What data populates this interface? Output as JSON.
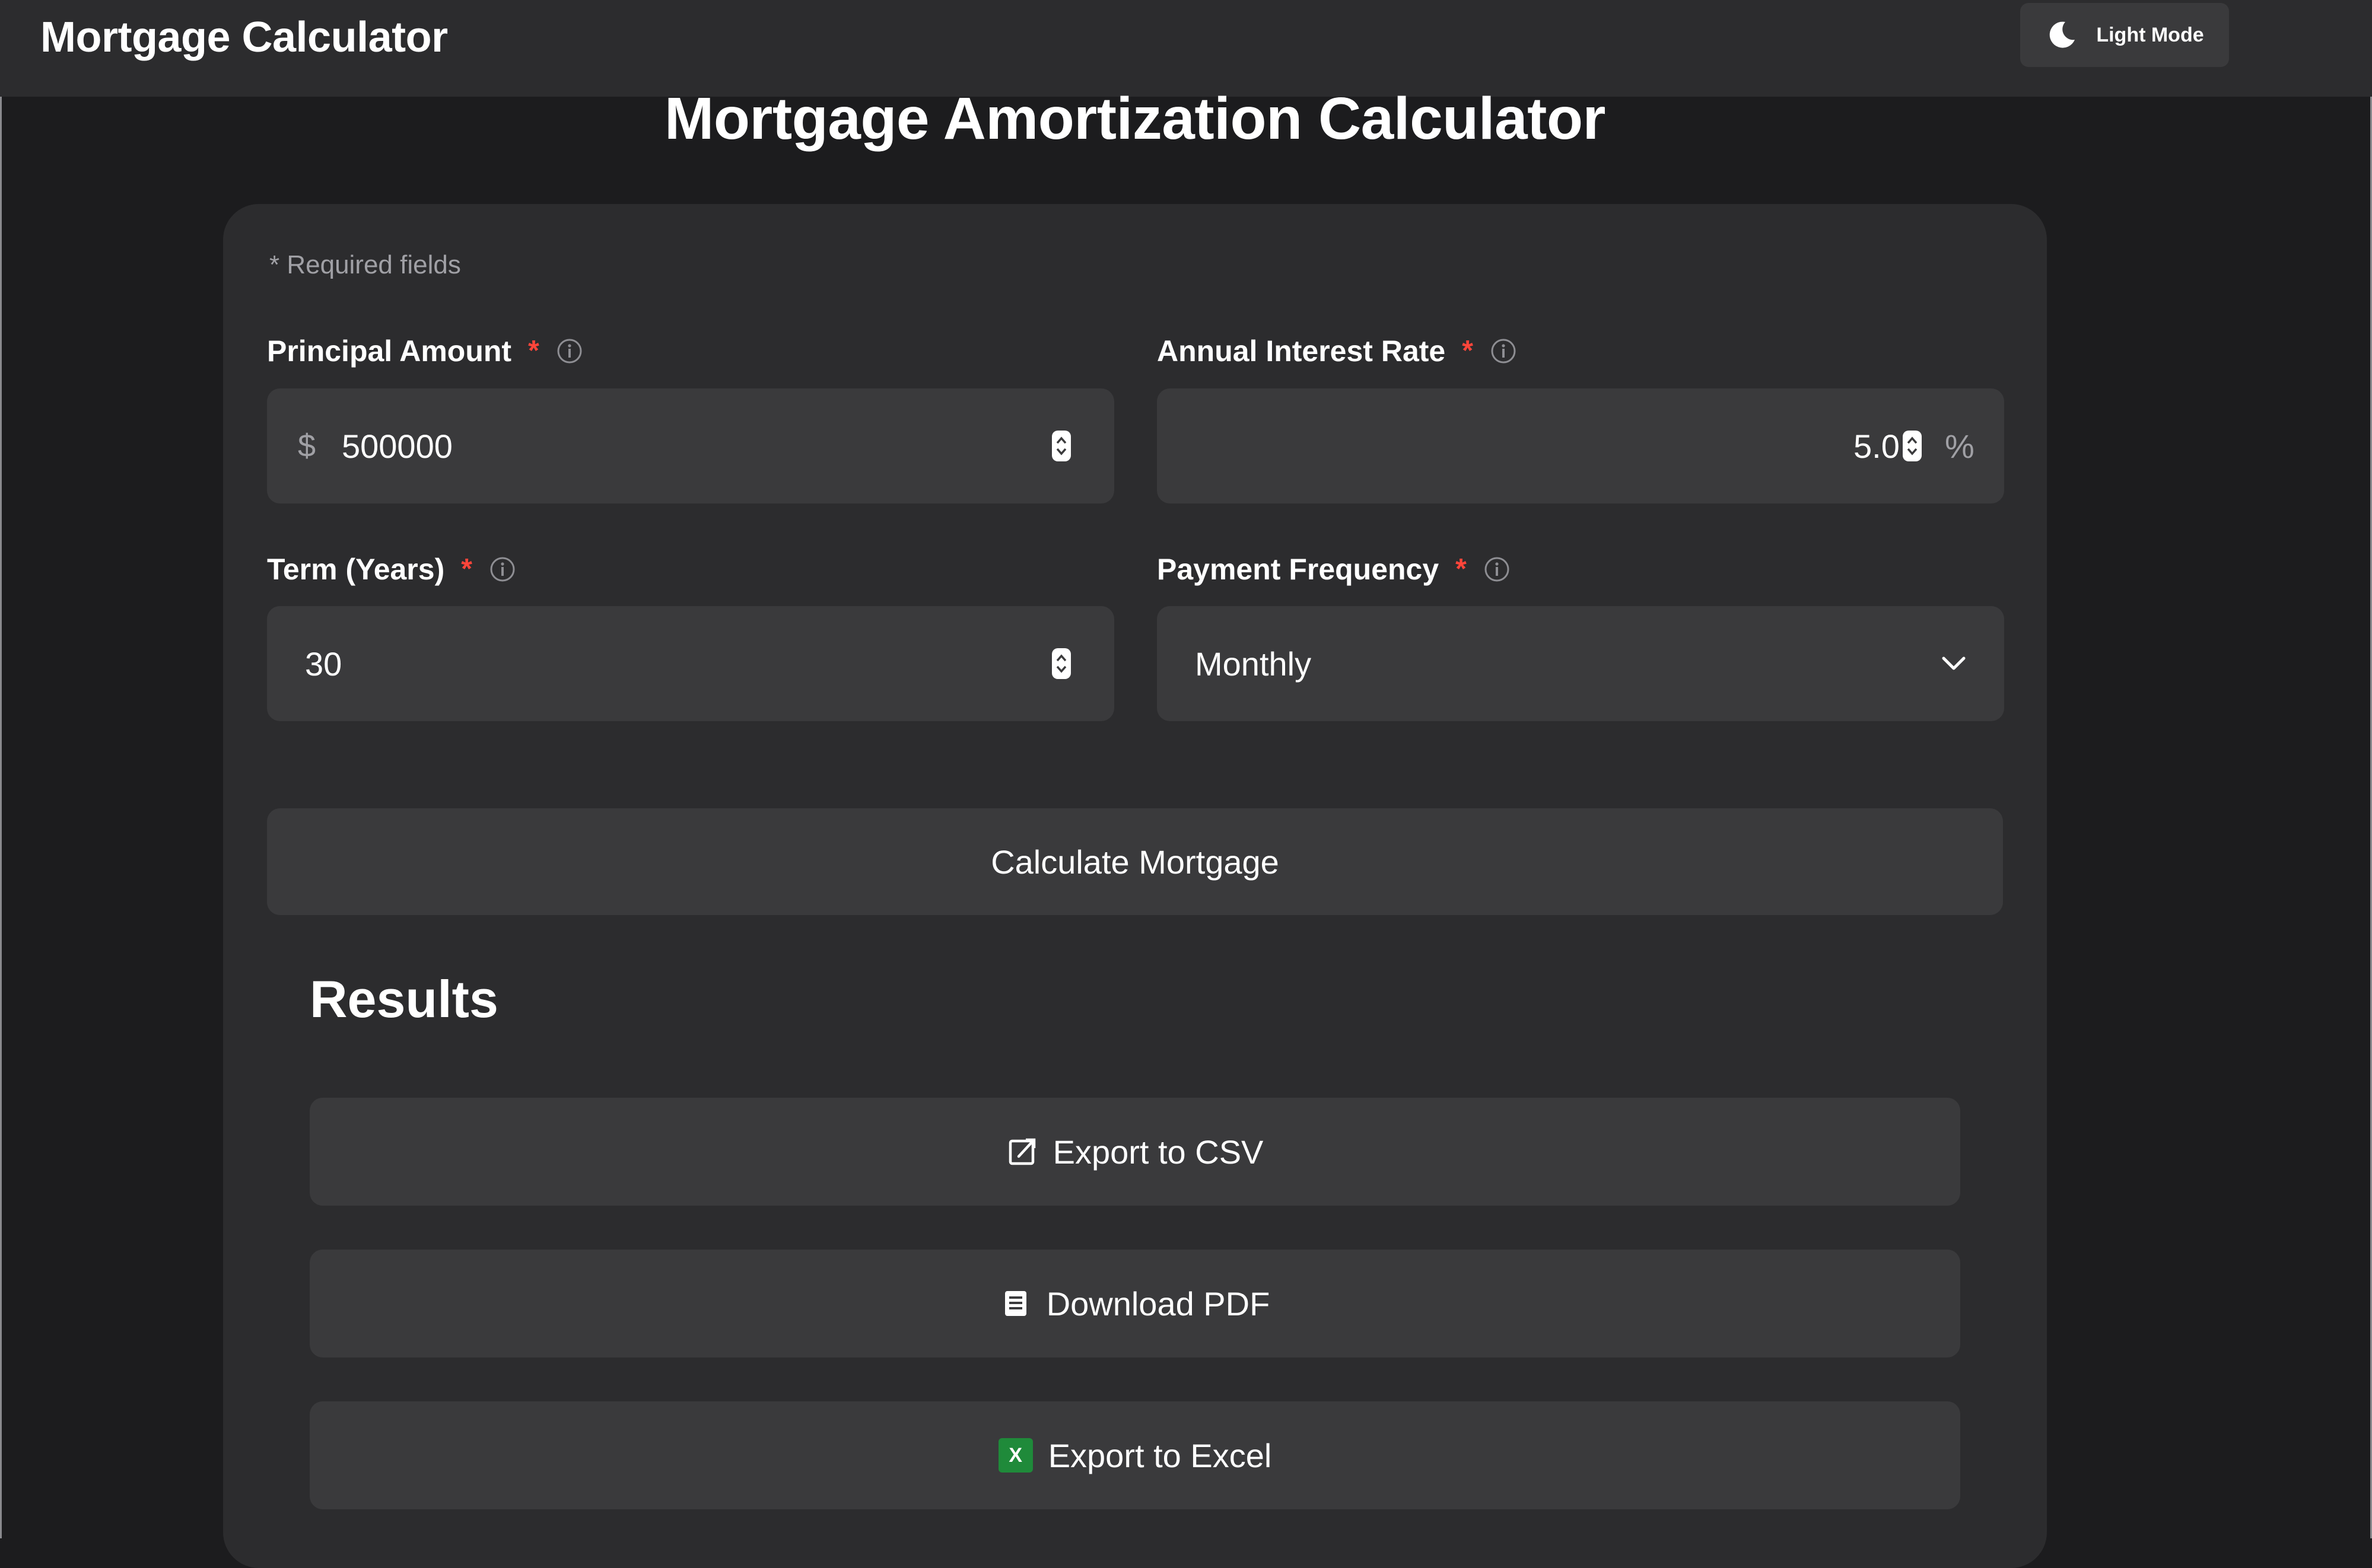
{
  "header": {
    "app_title": "Mortgage Calculator",
    "mode_toggle_label": "Light Mode",
    "mode_toggle_icon": "moon-icon"
  },
  "page": {
    "title": "Mortgage Amortization Calculator",
    "required_note": "* Required fields"
  },
  "form": {
    "principal": {
      "label": "Principal Amount",
      "required_mark": "*",
      "prefix": "$",
      "value": "500000"
    },
    "interest_rate": {
      "label": "Annual Interest Rate",
      "required_mark": "*",
      "value": "5.0",
      "suffix": "%"
    },
    "term": {
      "label": "Term (Years)",
      "required_mark": "*",
      "value": "30"
    },
    "payment_frequency": {
      "label": "Payment Frequency",
      "required_mark": "*",
      "selected": "Monthly"
    },
    "calculate_label": "Calculate Mortgage"
  },
  "results": {
    "heading": "Results",
    "export_csv_label": "Export to CSV",
    "download_pdf_label": "Download PDF",
    "export_excel_label": "Export to Excel",
    "excel_icon_letter": "X"
  },
  "colors": {
    "background": "#1c1c1e",
    "surface": "#2c2c2e",
    "control": "#3a3a3c",
    "required": "#ff453a",
    "excel_green": "#1f8a3a"
  }
}
